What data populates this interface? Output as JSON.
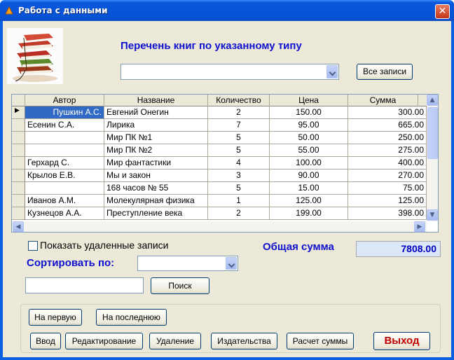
{
  "window": {
    "title": "Работа с данными",
    "close_glyph": "✕"
  },
  "heading": "Перечень книг по указанному типу",
  "type_combo": {
    "value": ""
  },
  "all_records_button": "Все записи",
  "grid": {
    "columns": [
      "Автор",
      "Название",
      "Количество",
      "Цена",
      "Сумма"
    ],
    "rows": [
      [
        "Пушкин А.С.",
        "Евгений Онегин",
        "2",
        "150.00",
        "300.00"
      ],
      [
        "Есенин С.А.",
        "Лирика",
        "7",
        "95.00",
        "665.00"
      ],
      [
        "",
        "Мир ПК №1",
        "5",
        "50.00",
        "250.00"
      ],
      [
        "",
        "Мир ПК №2",
        "5",
        "55.00",
        "275.00"
      ],
      [
        "Герхард С.",
        "Мир фантастики",
        "4",
        "100.00",
        "400.00"
      ],
      [
        "Крылов Е.В.",
        "Мы и закон",
        "3",
        "90.00",
        "270.00"
      ],
      [
        "",
        "168 часов № 55",
        "5",
        "15.00",
        "75.00"
      ],
      [
        "Иванов А.М.",
        "Молекулярная физика",
        "1",
        "125.00",
        "125.00"
      ],
      [
        "Кузнецов А.А.",
        "Преступление века",
        "2",
        "199.00",
        "398.00"
      ]
    ]
  },
  "show_deleted": {
    "label": "Показать удаленные записи",
    "checked": false
  },
  "total": {
    "label": "Общая сумма",
    "value": "7808.00"
  },
  "sort": {
    "label": "Сортировать по:",
    "value": ""
  },
  "search": {
    "value": "",
    "button": "Поиск"
  },
  "nav": {
    "first": "На первую",
    "last": "На последнюю"
  },
  "actions": {
    "input": "Ввод",
    "edit": "Редактирование",
    "delete": "Удаление",
    "publishers": "Издательства",
    "calc": "Расчет суммы",
    "exit": "Выход"
  },
  "colors": {
    "accent": "#1010d0",
    "exit": "#c00000"
  }
}
